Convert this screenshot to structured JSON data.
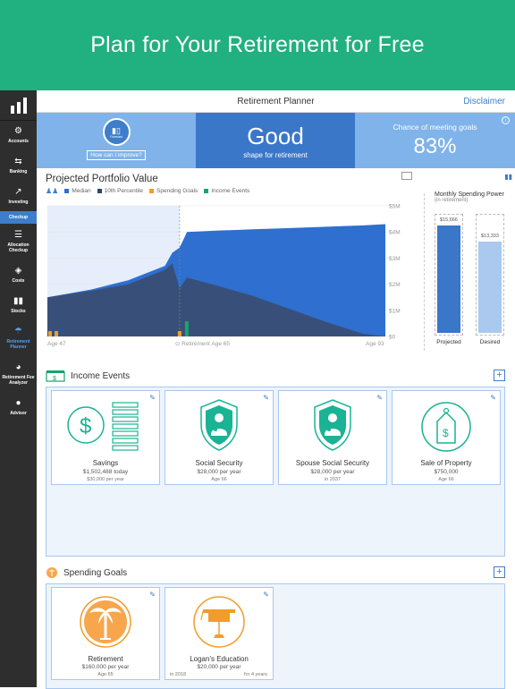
{
  "banner": {
    "title": "Plan for Your Retirement for Free"
  },
  "sidebar": {
    "items": [
      {
        "label": "Accounts",
        "icon": "gear-icon"
      },
      {
        "label": "Banking",
        "icon": "transfer-icon"
      },
      {
        "label": "Investing",
        "icon": "trend-icon"
      },
      {
        "label": "Checkup",
        "icon": ""
      },
      {
        "label": "Allocation Checkup",
        "icon": "sliders-icon"
      },
      {
        "label": "Costs",
        "icon": "tag-icon"
      },
      {
        "label": "Stocks",
        "icon": "bar-chart-icon"
      },
      {
        "label": "Retirement Planner",
        "icon": "planner-icon"
      },
      {
        "label": "Retirement Fee Analyzer",
        "icon": "pie-icon"
      },
      {
        "label": "Advisor",
        "icon": "person-icon"
      }
    ]
  },
  "header": {
    "title": "Retirement Planner",
    "disclaimer": "Disclaimer"
  },
  "summary": {
    "forecast_label": "Forecast",
    "improve_label": "How can I improve?",
    "status": "Good",
    "status_sub": "shape for retirement",
    "chance_label": "Chance of meeting goals",
    "chance_value": "83%"
  },
  "projection": {
    "title": "Projected Portfolio Value",
    "legend": [
      "Median",
      "10th Percentile",
      "Spending Goals",
      "Income Events"
    ],
    "axis_start": "Age 47",
    "axis_retire": "Retirement Age 65",
    "axis_end": "Age 93",
    "y_ticks": [
      "$5M",
      "$4M",
      "$3M",
      "$2M",
      "$1M",
      "$0"
    ],
    "colors": {
      "median": "#2e6fcf",
      "p10": "#3a4b6a",
      "spending": "#f39c2a",
      "income": "#1aa36e"
    }
  },
  "chart_data": {
    "type": "area",
    "x": [
      47,
      53,
      58,
      63,
      64,
      65,
      66,
      70,
      75,
      80,
      85,
      90,
      93
    ],
    "series": [
      {
        "name": "Median",
        "values": [
          1.5,
          1.8,
          2.15,
          2.7,
          3.2,
          3.4,
          4.0,
          4.05,
          4.1,
          4.15,
          4.2,
          4.25,
          4.3
        ]
      },
      {
        "name": "10th Percentile",
        "values": [
          1.5,
          1.75,
          2.0,
          2.55,
          2.8,
          1.85,
          2.25,
          1.95,
          1.55,
          1.05,
          0.55,
          0.1,
          0
        ]
      }
    ],
    "ylim": [
      0,
      5
    ],
    "xlim": [
      47,
      93
    ]
  },
  "spending_power": {
    "title": "Monthly Spending Power",
    "subtitle": "(in retirement)",
    "projected_value": "$15,666",
    "desired_value": "$13,333",
    "projected_label": "Projected",
    "desired_label": "Desired",
    "projected_amount": 15666,
    "desired_amount": 13333
  },
  "income_events": {
    "title": "Income Events",
    "cards": [
      {
        "name": "Savings",
        "amount": "$1,502,488 today",
        "meta": "$30,000 per year",
        "icon": "dollar-circle-icon"
      },
      {
        "name": "Social Security",
        "amount": "$28,000 per year",
        "meta": "Age 66",
        "icon": "shield-person-icon"
      },
      {
        "name": "Spouse Social Security",
        "amount": "$28,000 per year",
        "meta": "in 2037",
        "icon": "shield-person-icon"
      },
      {
        "name": "Sale of Property",
        "amount": "$750,000",
        "meta": "Age 66",
        "icon": "price-tag-icon"
      }
    ]
  },
  "spending_goals": {
    "title": "Spending Goals",
    "cards": [
      {
        "name": "Retirement",
        "amount": "$160,000 per year",
        "meta": "Age 65",
        "icon": "palm-tree-icon"
      },
      {
        "name": "Logan's Education",
        "amount": "$20,000 per year",
        "meta_left": "in 2018",
        "meta_right": "for 4 years",
        "icon": "graduation-cap-icon"
      }
    ]
  }
}
